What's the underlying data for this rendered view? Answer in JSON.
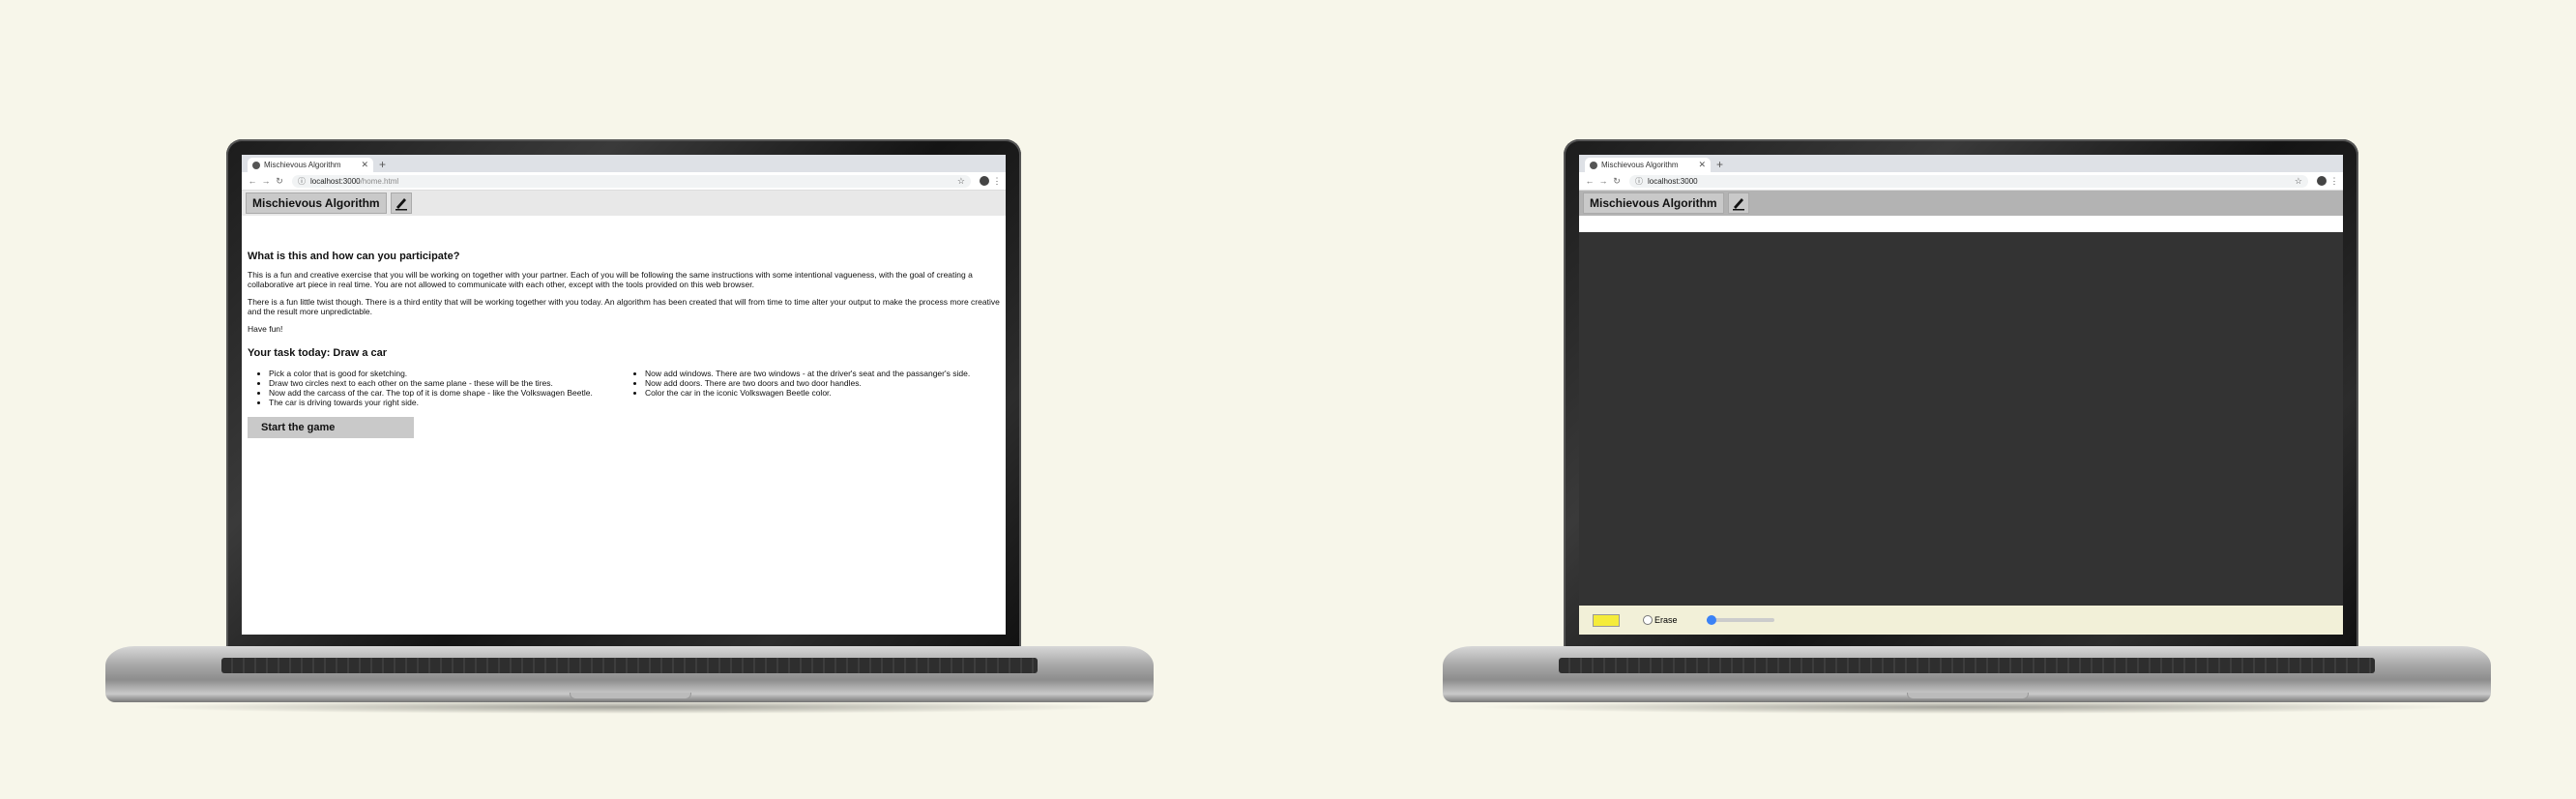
{
  "left": {
    "tab_title": "Mischievous Algorithm",
    "url_host": "localhost:3000",
    "url_path": "/home.html",
    "app_title": "Mischievous Algorithm",
    "heading1": "What is this and how can you participate?",
    "para1": "This is a fun and creative exercise that you will be working on together with your partner. Each of you will be following the same instructions with some intentional vagueness, with the goal of creating a collaborative art piece in real time. You are not allowed to communicate with each other, except with the tools provided on this web browser.",
    "para2": "There is a fun little twist though. There is a third entity that will be working together with you today. An algorithm has been created that will from time to time alter your output to make the process more creative and the result more unpredictable.",
    "para3": "Have fun!",
    "heading2": "Your task today: Draw a car",
    "list_left": [
      "Pick a color that is good for sketching.",
      "Draw two circles next to each other on the same plane - these will be the tires.",
      "Now add the carcass of the car. The top of it is dome shape - like the Volkswagen Beetle.",
      "The car is driving towards your right side."
    ],
    "list_right": [
      "Now add windows. There are two windows - at the driver's seat and the passanger's side.",
      "Now add doors. There are two doors and two door handles.",
      "Color the car in the iconic Volkswagen Beetle color."
    ],
    "start_button": "Start the game"
  },
  "right": {
    "tab_title": "Mischievous Algorithm",
    "url_host": "localhost:3000",
    "app_title": "Mischievous Algorithm",
    "erase_label": "Erase",
    "color_swatch": "#f5ec3a",
    "brush_size_fraction": 0.08
  },
  "colors": {
    "canvas": "#333333",
    "background": "#f7f6ea"
  }
}
